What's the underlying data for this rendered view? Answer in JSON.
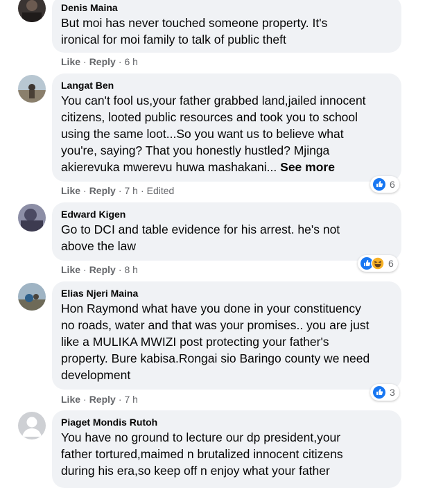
{
  "comments": [
    {
      "author": "Denis Maina",
      "lines": [
        "But moi has never touched someone property. It's",
        "ironical for moi family to talk of public theft"
      ],
      "like_label": "Like",
      "reply_label": "Reply",
      "time": "6 h"
    },
    {
      "author": "Langat Ben",
      "lines": [
        "You can't fool us,your father grabbed land,jailed innocent",
        "citizens, looted public resources and took you to school",
        "using the same loot...So you want us to believe what",
        "you're, saying? That you honestly hustled? Mjinga",
        "akierevuka mwerevu huwa mashakani..."
      ],
      "see_more": "See more",
      "like_label": "Like",
      "reply_label": "Reply",
      "time": "7 h",
      "edited": "Edited",
      "reaction_count": "6",
      "reactions": [
        "like-icon"
      ]
    },
    {
      "author": "Edward Kigen",
      "lines": [
        "Go to DCI and table evidence for his arrest. he's not",
        "above the law"
      ],
      "like_label": "Like",
      "reply_label": "Reply",
      "time": "8 h",
      "reaction_count": "6",
      "reactions": [
        "like-icon",
        "haha-icon"
      ]
    },
    {
      "author": "Elias Njeri Maina",
      "lines": [
        "Hon Raymond what have you done in your constituency",
        "no roads, water and that was your promises.. you are just",
        "like a MULIKA MWIZI post protecting your father's",
        "property. Bure kabisa.Rongai sio Baringo county we need",
        "development"
      ],
      "like_label": "Like",
      "reply_label": "Reply",
      "time": "7 h",
      "reaction_count": "3",
      "reactions": [
        "like-icon"
      ]
    },
    {
      "author": "Piaget Mondis Rutoh",
      "lines": [
        "You have no ground to lecture our dp president,your",
        "father tortured,maimed n brutalized innocent citizens",
        "during his era,so keep off n enjoy what your father"
      ]
    }
  ],
  "colors": {
    "bubble": "#f0f2f5",
    "meta": "#65676b",
    "like_blue": "#1877f2",
    "haha_yellow": "#f7b125"
  }
}
